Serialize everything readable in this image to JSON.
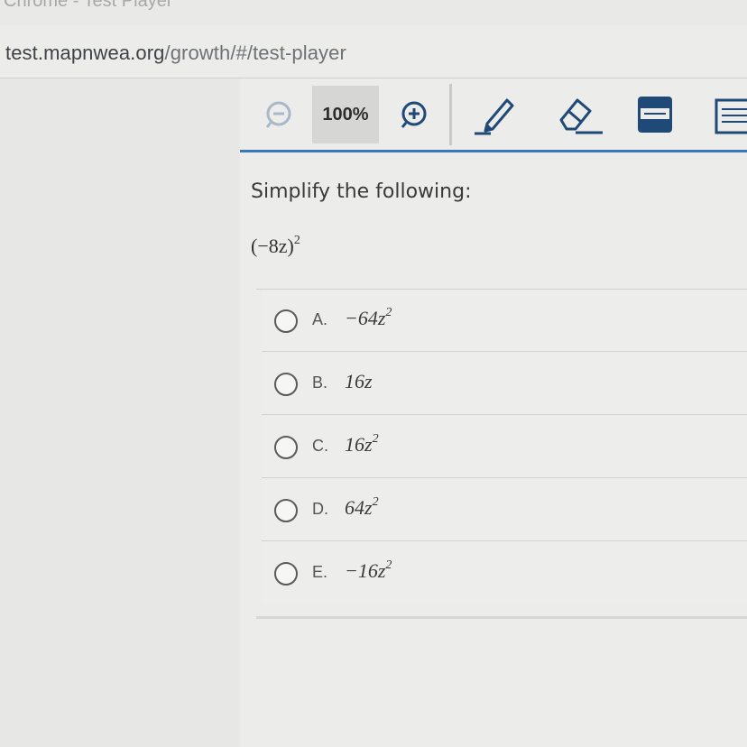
{
  "window": {
    "title": "Chrome - Test Player"
  },
  "browser": {
    "url_host": "test.mapnwea.org",
    "url_path": "/growth/#/test-player"
  },
  "toolbar": {
    "zoom_level": "100%",
    "icons": [
      "zoom-out-icon",
      "zoom-in-icon",
      "highlighter-icon",
      "eraser-icon",
      "line-reader-icon",
      "notepad-icon"
    ],
    "accent_color": "#3a78b8"
  },
  "question": {
    "prompt": "Simplify the following:",
    "expression_base": "(−8z)",
    "expression_exp": "2"
  },
  "choices": [
    {
      "letter": "A.",
      "text": "−64z",
      "exp": "2"
    },
    {
      "letter": "B.",
      "text": "16z",
      "exp": ""
    },
    {
      "letter": "C.",
      "text": "16z",
      "exp": "2"
    },
    {
      "letter": "D.",
      "text": "64z",
      "exp": "2"
    },
    {
      "letter": "E.",
      "text": "−16z",
      "exp": "2"
    }
  ]
}
